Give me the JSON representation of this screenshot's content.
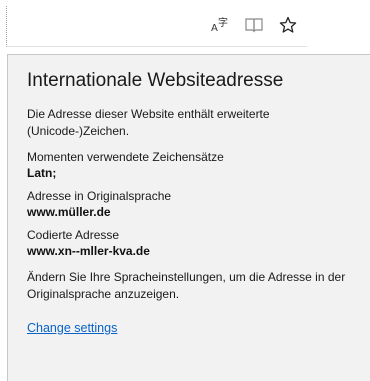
{
  "addressbar": {
    "icons": [
      "translate-icon",
      "reading-view-icon",
      "favorite-star-icon"
    ],
    "translate_glyph": "A字"
  },
  "flyout": {
    "title": "Internationale Websiteadresse",
    "description": "Die Adresse dieser Website enthält erweiterte (Unicode-)Zeichen.",
    "fields": [
      {
        "label": "Momenten verwendete Zeichensätze",
        "value": "Latn;"
      },
      {
        "label": "Adresse in Originalsprache",
        "value": "www.müller.de"
      },
      {
        "label": "Codierte Adresse",
        "value": "www.xn--mller-kva.de"
      }
    ],
    "footer": "Ändern Sie Ihre Spracheinstellungen, um die Adresse in der Originalsprache anzuzeigen.",
    "link_label": "Change settings"
  },
  "colors": {
    "panel_bg": "#f2f2f2",
    "link": "#0a63c9"
  }
}
